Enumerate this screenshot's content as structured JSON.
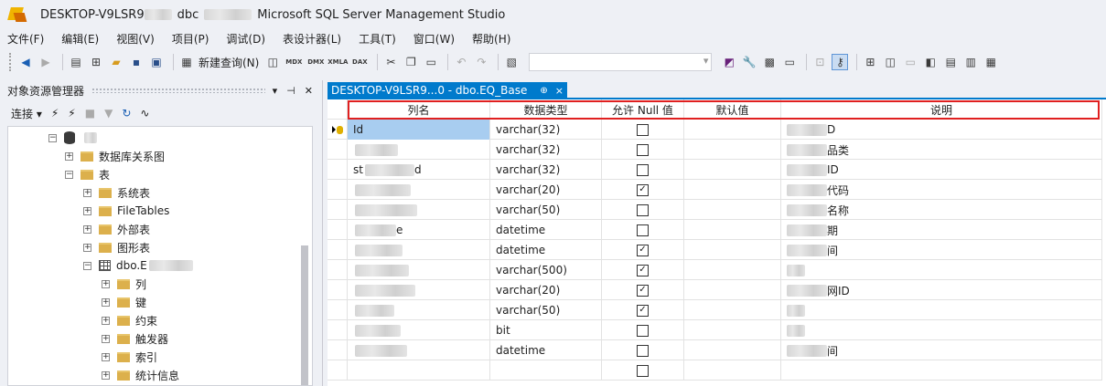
{
  "titlebar": {
    "host": "DESKTOP-V9LSR9",
    "db_prefix": "dbc",
    "app_name": "Microsoft SQL Server Management Studio"
  },
  "menu": [
    "文件(F)",
    "编辑(E)",
    "视图(V)",
    "项目(P)",
    "调试(D)",
    "表设计器(L)",
    "工具(T)",
    "窗口(W)",
    "帮助(H)"
  ],
  "toolbar": {
    "new_query": "新建查询(N)",
    "mdx": "MDX",
    "dmx": "DMX",
    "xmla": "XMLA",
    "dax": "DAX"
  },
  "object_explorer": {
    "title": "对象资源管理器",
    "connect": "连接",
    "tree": {
      "db_diagrams": "数据库关系图",
      "tables": "表",
      "system_tables": "系统表",
      "file_tables": "FileTables",
      "external_tables": "外部表",
      "graph_tables": "图形表",
      "table_name": "dbo.E",
      "columns": "列",
      "keys": "键",
      "constraints": "约束",
      "triggers": "触发器",
      "indexes": "索引",
      "statistics": "统计信息"
    }
  },
  "document_tab": {
    "title": "DESKTOP-V9LSR9...0 - dbo.EQ_Base",
    "pin": "⊕",
    "close": "×"
  },
  "designer": {
    "headers": {
      "column_name": "列名",
      "data_type": "数据类型",
      "allow_null": "允许 Null 值",
      "default": "默认值",
      "description": "说明"
    },
    "rows": [
      {
        "name": "Id",
        "type": "varchar(32)",
        "nullable": false,
        "desc": "D"
      },
      {
        "name": "",
        "type": "varchar(32)",
        "nullable": false,
        "desc": "品类"
      },
      {
        "name": "st",
        "name_tail": "d",
        "type": "varchar(32)",
        "nullable": false,
        "desc": "ID"
      },
      {
        "name": "",
        "type": "varchar(20)",
        "nullable": true,
        "desc": "代码"
      },
      {
        "name": "",
        "type": "varchar(50)",
        "nullable": false,
        "desc": "名称"
      },
      {
        "name": "",
        "name_tail": "e",
        "type": "datetime",
        "nullable": false,
        "desc": "期"
      },
      {
        "name": "",
        "type": "datetime",
        "nullable": true,
        "desc": "间"
      },
      {
        "name": "",
        "type": "varchar(500)",
        "nullable": true,
        "desc": ""
      },
      {
        "name": "",
        "type": "varchar(20)",
        "nullable": true,
        "desc": "网ID"
      },
      {
        "name": "",
        "type": "varchar(50)",
        "nullable": true,
        "desc": ""
      },
      {
        "name": "",
        "type": "bit",
        "nullable": false,
        "desc": ""
      },
      {
        "name": "",
        "type": "datetime",
        "nullable": false,
        "desc": "间"
      },
      {
        "name": "",
        "type": "",
        "nullable": false,
        "desc": ""
      }
    ]
  }
}
